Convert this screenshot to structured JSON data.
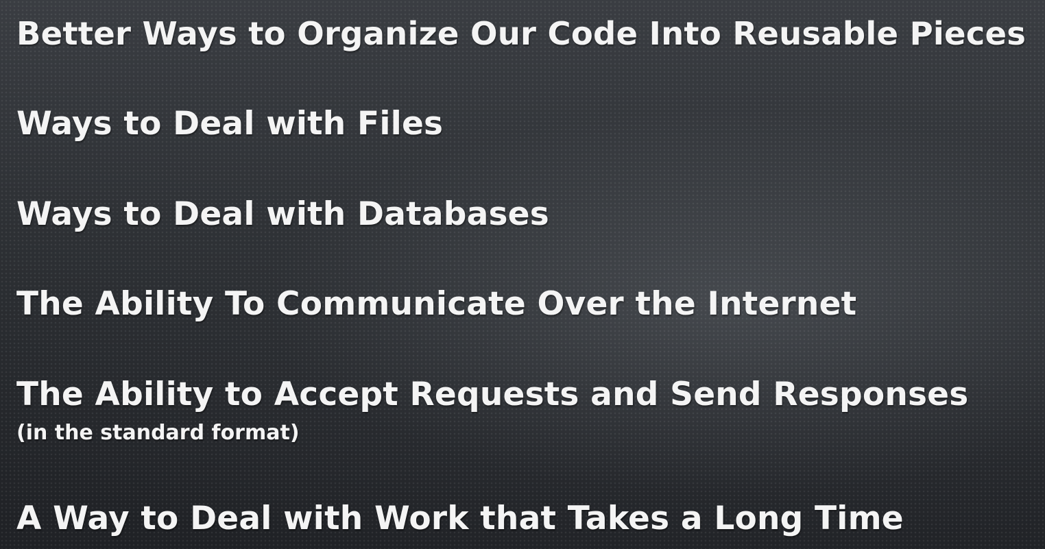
{
  "slide": {
    "items": [
      {
        "text": "Better Ways to Organize Our Code Into Reusable Pieces"
      },
      {
        "text": "Ways to Deal with Files"
      },
      {
        "text": "Ways to Deal with Databases"
      },
      {
        "text": "The Ability To Communicate Over the Internet"
      },
      {
        "text": "The Ability to Accept Requests and Send Responses",
        "note": "(in the standard format)"
      },
      {
        "text": "A Way to Deal with Work that Takes a Long Time"
      }
    ]
  },
  "colors": {
    "text": "#f4f4f4",
    "background": "#2a2d31"
  }
}
